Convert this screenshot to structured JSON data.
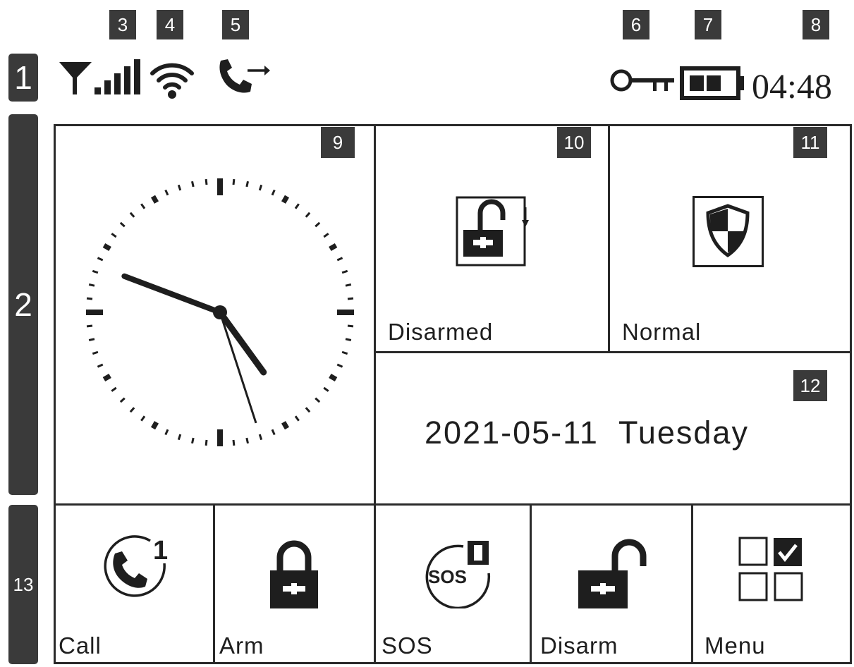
{
  "callouts": {
    "status_bar": "1",
    "main_area": "2",
    "signal": "3",
    "wifi": "4",
    "call_forward": "5",
    "key": "6",
    "battery": "7",
    "time": "8",
    "clock": "9",
    "arm_state": "10",
    "status": "11",
    "date": "12",
    "shortcuts": "13"
  },
  "status_bar": {
    "time": "04:48",
    "icons": [
      "antenna-icon",
      "signal-bars-icon",
      "wifi-icon",
      "call-forward-icon",
      "key-icon",
      "battery-icon"
    ]
  },
  "clock": {
    "hours": 4,
    "minutes": 48,
    "seconds": 27
  },
  "tiles": {
    "arm_state_label": "Disarmed",
    "status_label": "Normal",
    "date_text": "2021-05-11  Tuesday"
  },
  "shortcuts": [
    {
      "label": "Call",
      "icon": "call-icon"
    },
    {
      "label": "Arm",
      "icon": "lock-closed-icon"
    },
    {
      "label": "SOS",
      "icon": "sos-icon"
    },
    {
      "label": "Disarm",
      "icon": "lock-open-icon"
    },
    {
      "label": "Menu",
      "icon": "menu-grid-icon"
    }
  ],
  "colors": {
    "callout_bg": "#3a3a3a",
    "ink": "#1e1e1e",
    "background": "#ffffff"
  }
}
